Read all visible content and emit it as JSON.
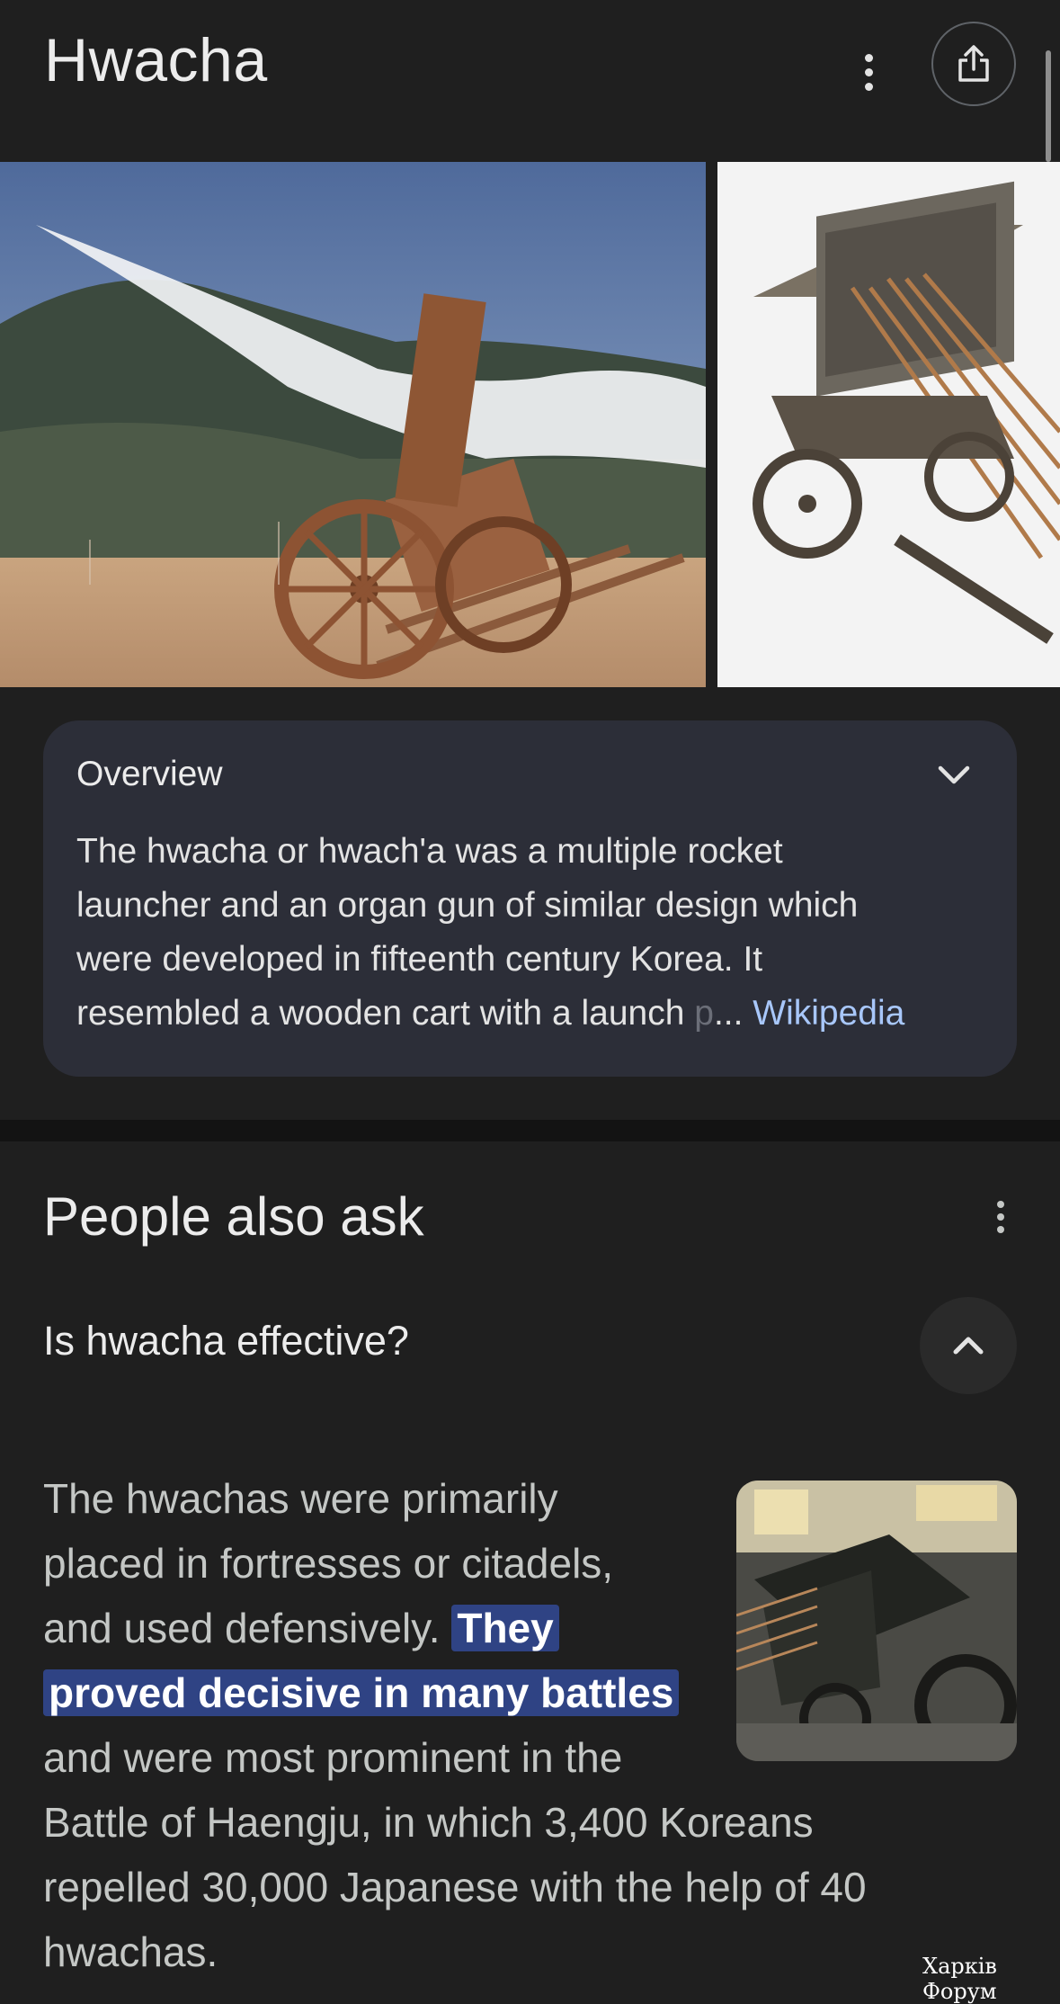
{
  "header": {
    "title": "Hwacha",
    "more_icon": "more-vert-icon",
    "share_icon": "share-icon"
  },
  "images": [
    {
      "alt": "Hwacha firing arrows, smoke trail, wooden cart"
    },
    {
      "alt": "3D model of hwacha cart with arrows"
    }
  ],
  "overview": {
    "label": "Overview",
    "lines": [
      "The hwacha or hwach'a was a multiple rocket",
      "launcher and an organ gun of similar design which",
      "were developed in fifteenth century Korea. It"
    ],
    "last_line": "resembled a wooden cart with a launch ",
    "faded_char": "p",
    "ellipsis": "... ",
    "source_link": "Wikipedia",
    "chevron_icon": "chevron-down-icon"
  },
  "people_also_ask": {
    "title": "People also ask",
    "question": "Is hwacha effective?",
    "collapse_icon": "chevron-up-icon",
    "answer": {
      "line1": "The hwachas were primarily",
      "line2": "placed in fortresses or citadels,",
      "line3_pre": "and used defensively. ",
      "line3_hl": "They",
      "line4_hl": "proved decisive in many battles",
      "line5": "and were most prominent in the",
      "line6": "Battle of Haengju, in which 3,400 Koreans",
      "line7": "repelled 30,000 Japanese with the help of 40",
      "line8": "hwachas."
    }
  },
  "watermark": "Харків Форум",
  "colors": {
    "background": "#1f1f1f",
    "card": "#2c2e38",
    "link": "#a8c7fa",
    "highlight": "#2f4384"
  }
}
